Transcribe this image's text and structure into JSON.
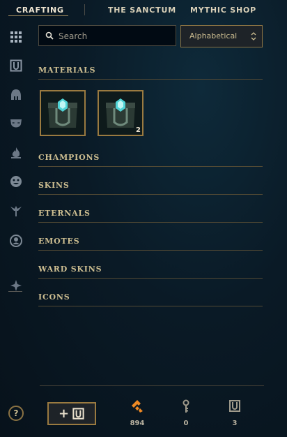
{
  "nav": {
    "tabs": [
      {
        "label": "CRAFTING",
        "active": true
      },
      {
        "label": "THE SANCTUM",
        "active": false
      },
      {
        "label": "MYTHIC SHOP",
        "active": false
      }
    ]
  },
  "sidebar": {
    "items": [
      {
        "icon": "grid-icon"
      },
      {
        "icon": "chest-icon"
      },
      {
        "icon": "champion-helmet-icon"
      },
      {
        "icon": "skin-mask-icon"
      },
      {
        "icon": "eternals-flame-icon"
      },
      {
        "icon": "emote-face-icon"
      },
      {
        "icon": "ward-icon"
      },
      {
        "icon": "summoner-icon"
      },
      {
        "icon": "other-icon"
      }
    ]
  },
  "search": {
    "placeholder": "Search"
  },
  "sort": {
    "selected": "Alphabetical"
  },
  "sections": [
    {
      "label": "MATERIALS"
    },
    {
      "label": "CHAMPIONS"
    },
    {
      "label": "SKINS"
    },
    {
      "label": "ETERNALS"
    },
    {
      "label": "EMOTES"
    },
    {
      "label": "WARD SKINS"
    },
    {
      "label": "ICONS"
    }
  ],
  "materials": [
    {
      "icon": "hextech-chest-icon",
      "count": ""
    },
    {
      "icon": "hextech-chest-icon",
      "count": "2"
    }
  ],
  "footer": {
    "help_label": "?",
    "add_label": "+",
    "currencies": [
      {
        "icon": "orange-essence-icon",
        "value": "894",
        "color": "#f08a24"
      },
      {
        "icon": "key-icon",
        "value": "0",
        "color": "#a09b8c"
      },
      {
        "icon": "chest-icon",
        "value": "3",
        "color": "#a09b8c"
      }
    ]
  },
  "colors": {
    "accent_gold": "#c8aa6e",
    "background": "#0a1a26"
  }
}
